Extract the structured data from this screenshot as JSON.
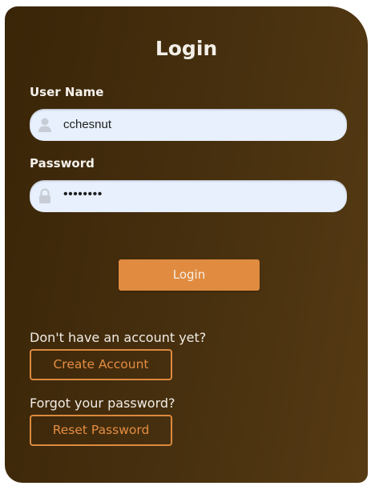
{
  "login_form": {
    "title": "Login",
    "username_label": "User Name",
    "username_value": "cchesnut",
    "password_label": "Password",
    "password_value": "••••••••",
    "login_button": "Login",
    "no_account_prompt": "Don't have an account yet?",
    "create_account_button": "Create Account",
    "forgot_prompt": "Forgot your password?",
    "reset_password_button": "Reset Password"
  },
  "icons": {
    "username": "user-icon",
    "password": "lock-icon"
  },
  "colors": {
    "card_background": "#47300f",
    "accent": "#e08b3f",
    "input_background": "#e8f0fe"
  }
}
